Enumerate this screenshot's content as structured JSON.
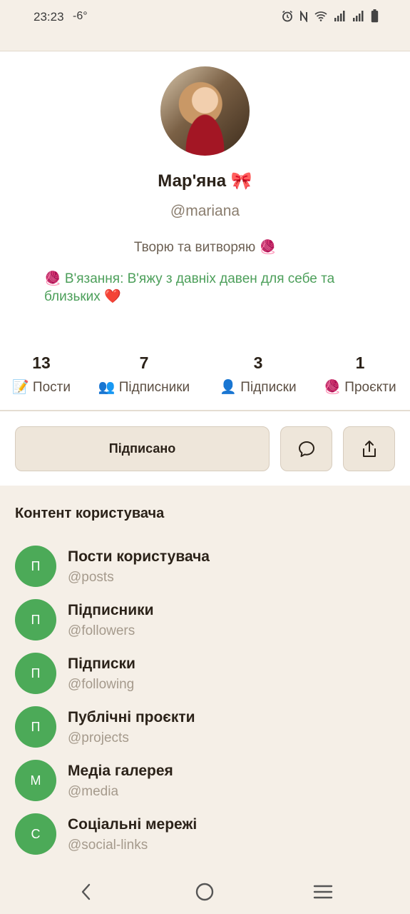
{
  "status_bar": {
    "time": "23:23",
    "temperature": "-6°",
    "icons": [
      "alarm-icon",
      "nfc-icon",
      "wifi-icon",
      "signal-icon",
      "signal-icon",
      "battery-icon"
    ]
  },
  "profile": {
    "name": "Мар'яна 🎀",
    "handle": "@mariana",
    "bio": "Творю та витворяю 🧶",
    "hobby": "🧶 В'язання: В'яжу з давніх давен для себе та близьких ❤️"
  },
  "stats": [
    {
      "value": "13",
      "label": "📝 Пости"
    },
    {
      "value": "7",
      "label": "👥 Підписники"
    },
    {
      "value": "3",
      "label": "👤 Підписки"
    },
    {
      "value": "1",
      "label": "🧶 Проєкти"
    }
  ],
  "actions": {
    "follow_label": "Підписано",
    "message_icon": "chat-bubble-icon",
    "share_icon": "share-icon"
  },
  "content": {
    "title": "Контент користувача",
    "items": [
      {
        "letter": "П",
        "title": "Пости користувача",
        "handle": "@posts"
      },
      {
        "letter": "П",
        "title": "Підписники",
        "handle": "@followers"
      },
      {
        "letter": "П",
        "title": "Підписки",
        "handle": "@following"
      },
      {
        "letter": "П",
        "title": "Публічні проєкти",
        "handle": "@projects"
      },
      {
        "letter": "М",
        "title": "Медіа галерея",
        "handle": "@media"
      },
      {
        "letter": "С",
        "title": "Соціальні мережі",
        "handle": "@social-links"
      }
    ]
  },
  "colors": {
    "accent_green": "#4caa58",
    "background_beige": "#f5efe7",
    "button_beige": "#eee6da",
    "text_dark": "#2b2219"
  }
}
